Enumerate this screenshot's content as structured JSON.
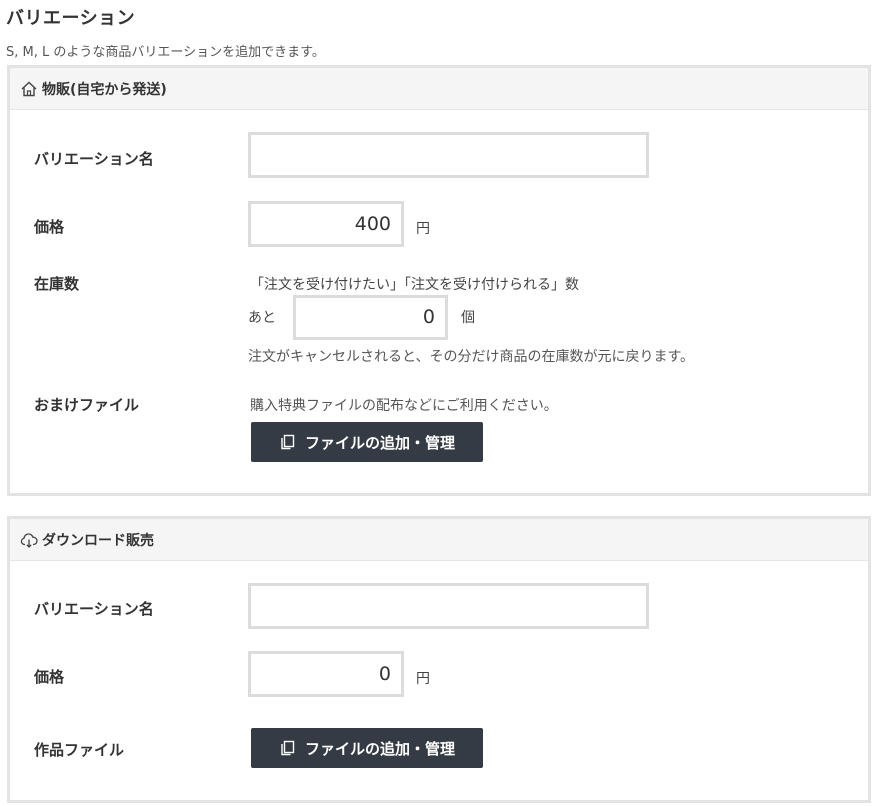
{
  "header": {
    "title": "バリエーション",
    "subtitle": "S, M, L のような商品バリエーションを追加できます。"
  },
  "physical": {
    "section_title": "物販(自宅から発送)",
    "variation_name_label": "バリエーション名",
    "variation_name_value": "",
    "price_label": "価格",
    "price_value": "400",
    "price_unit": "円",
    "stock_label": "在庫数",
    "stock_help": "「注文を受け付けたい」「注文を受け付けられる」数",
    "stock_prefix": "あと",
    "stock_value": "0",
    "stock_unit": "個",
    "stock_note": "注文がキャンセルされると、その分だけ商品の在庫数が元に戻ります。",
    "bonus_label": "おまけファイル",
    "bonus_help": "購入特典ファイルの配布などにご利用ください。",
    "file_button_label": "ファイルの追加・管理"
  },
  "download": {
    "section_title": "ダウンロード販売",
    "variation_name_label": "バリエーション名",
    "variation_name_value": "",
    "price_label": "価格",
    "price_value": "0",
    "price_unit": "円",
    "work_file_label": "作品ファイル",
    "file_button_label": "ファイルの追加・管理"
  },
  "icons": {
    "physical_section": "home-icon",
    "download_section": "cloud-download-icon",
    "file_button": "copy-files-icon"
  },
  "colors": {
    "button_bg": "#353b44",
    "panel_border": "#e3e3e3",
    "panel_header_bg": "#f5f5f5"
  }
}
